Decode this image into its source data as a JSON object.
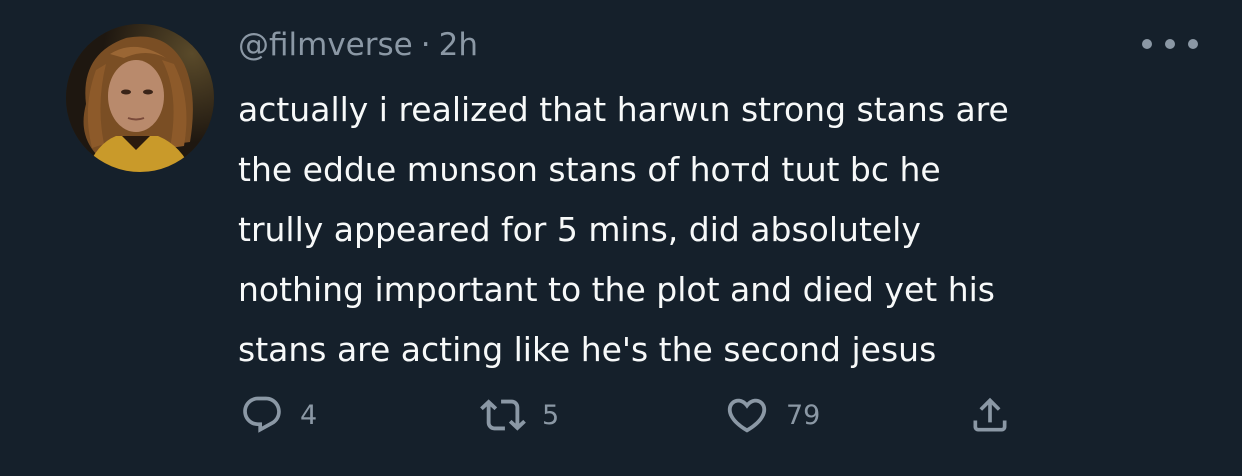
{
  "tweet": {
    "handle": "@filmverse",
    "separator": "·",
    "time": "2h",
    "text": "actually i realized that harwɩn strong stans are\nthe eddɩe mʋnson stans of hoᴛd tɯt bc he\ntrully appeared for 5 mins, did absolutely\nnothing important to the plot and died yet his\nstans are acting like he's the second jesus",
    "more_icon": "more-horizontal-icon",
    "avatar_icon": "profile-photo"
  },
  "actions": {
    "reply": {
      "icon": "reply-icon",
      "count": "4"
    },
    "retweet": {
      "icon": "retweet-icon",
      "count": "5"
    },
    "like": {
      "icon": "heart-icon",
      "count": "79"
    },
    "share": {
      "icon": "share-icon"
    }
  },
  "colors": {
    "background": "#15202b",
    "text": "#f7f9f9",
    "secondary": "#8b98a5"
  }
}
